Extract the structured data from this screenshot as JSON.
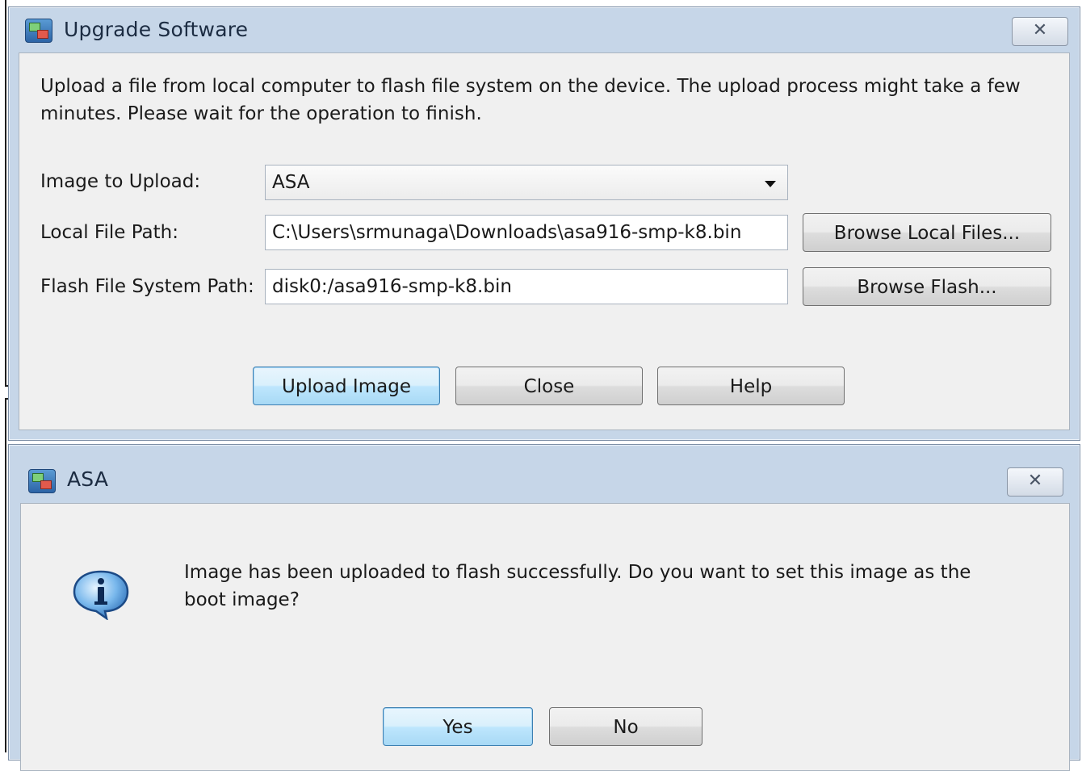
{
  "upgrade_dialog": {
    "title": "Upgrade Software",
    "close_label": "✕",
    "description": "Upload a file from local computer to flash file system on the device. The upload process might take a few minutes. Please wait for the operation to finish.",
    "image_label": "Image to Upload:",
    "image_value": "ASA",
    "local_path_label": "Local File Path:",
    "local_path_value": "C:\\Users\\srmunaga\\Downloads\\asa916-smp-k8.bin",
    "browse_local_label": "Browse Local Files...",
    "flash_path_label": "Flash File System Path:",
    "flash_path_value": "disk0:/asa916-smp-k8.bin",
    "browse_flash_label": "Browse Flash...",
    "upload_label": "Upload Image",
    "close_button_label": "Close",
    "help_label": "Help"
  },
  "asa_dialog": {
    "title": "ASA",
    "close_label": "✕",
    "message": "Image has been uploaded to flash successfully. Do you want to set this image as the boot image?",
    "yes_label": "Yes",
    "no_label": "No"
  },
  "icons": {
    "app": "app-window-icon",
    "info": "info-icon"
  },
  "colors": {
    "titlebar": "#c6d6e8",
    "client": "#f0f0f0",
    "default_button": "#bee6fd"
  }
}
